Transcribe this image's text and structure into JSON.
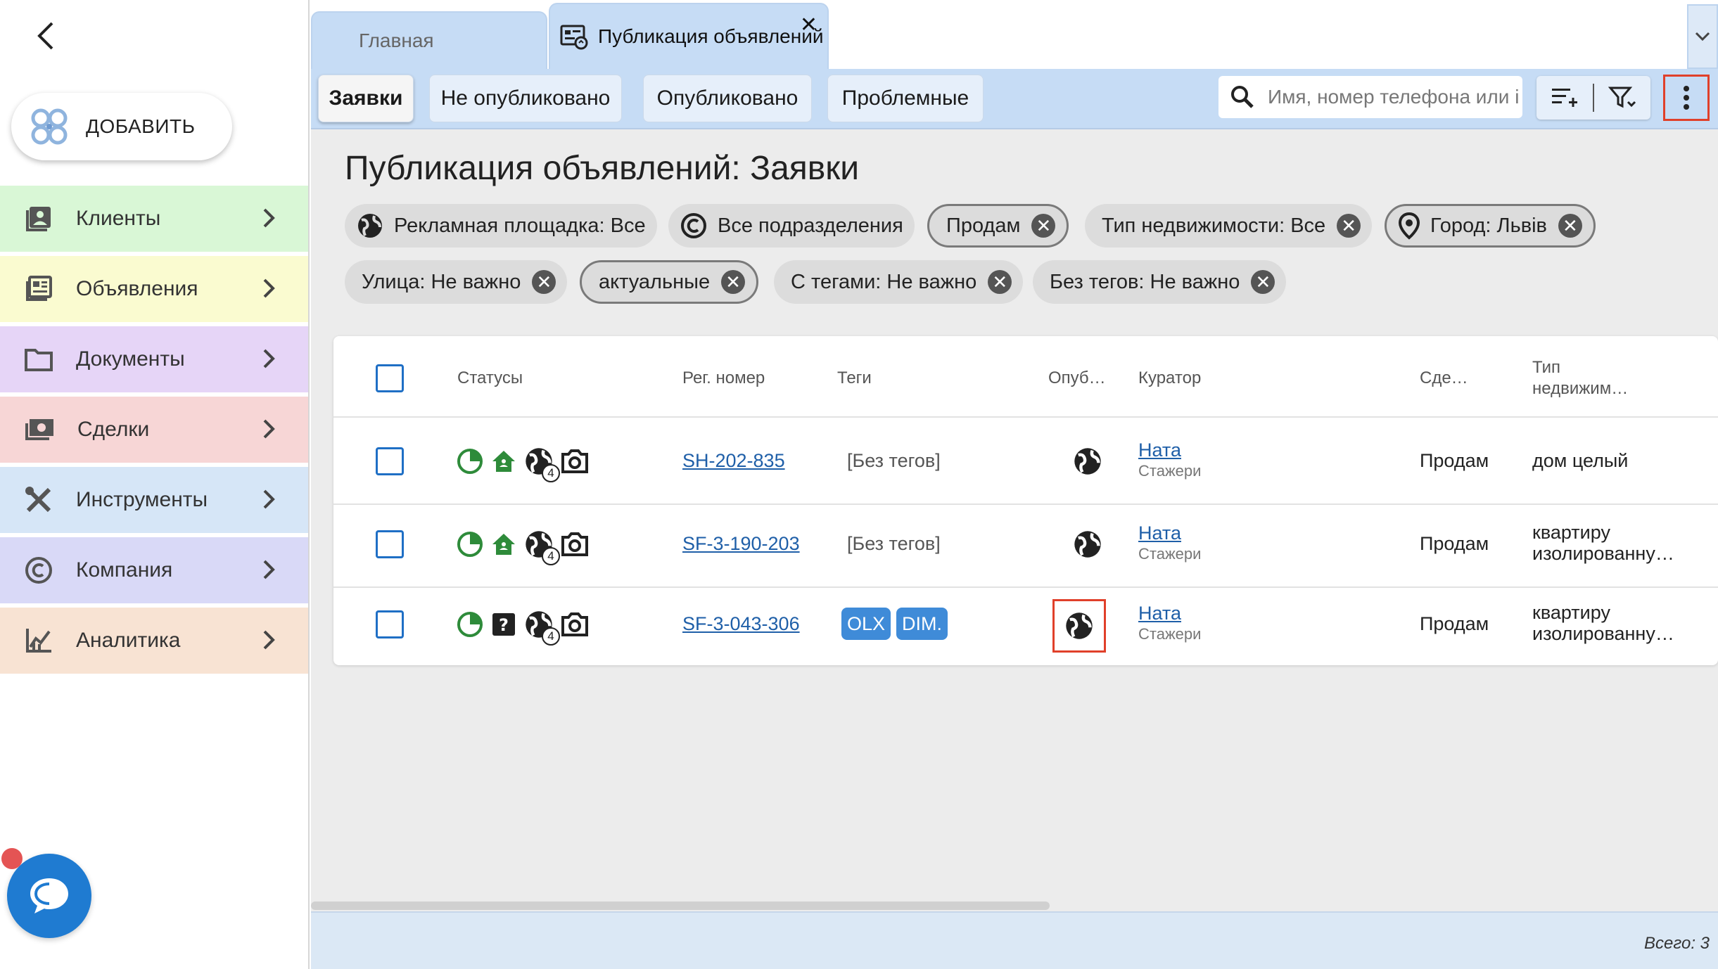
{
  "sidebar": {
    "add_label": "ДОБАВИТЬ",
    "items": [
      {
        "label": "Клиенты",
        "color": "#d9f7d6"
      },
      {
        "label": "Объявления",
        "color": "#fafbd0"
      },
      {
        "label": "Документы",
        "color": "#e6d5f7"
      },
      {
        "label": "Сделки",
        "color": "#f7d6d6"
      },
      {
        "label": "Инструменты",
        "color": "#d6e6f7"
      },
      {
        "label": "Компания",
        "color": "#d9d9f7"
      },
      {
        "label": "Аналитика",
        "color": "#f8e3d3"
      }
    ]
  },
  "tabs": {
    "home": "Главная",
    "active": "Публикация объявлений",
    "close": "✕"
  },
  "toolbar": {
    "tabs": [
      "Заявки",
      "Не опубликовано",
      "Опубликовано",
      "Проблемные"
    ],
    "search_placeholder": "Имя, номер телефона или i"
  },
  "page": {
    "title": "Публикация объявлений: Заявки"
  },
  "filters": [
    {
      "label": "Рекламная площадка: Все",
      "icon": "globe-icon",
      "removable": false,
      "outlined": false
    },
    {
      "label": "Все подразделения",
      "icon": "copyright-icon",
      "removable": false,
      "outlined": false
    },
    {
      "label": "Продам",
      "icon": null,
      "removable": true,
      "outlined": true
    },
    {
      "label": "Тип недвижимости: Все",
      "icon": null,
      "removable": true,
      "outlined": false
    },
    {
      "label": "Город: Львів",
      "icon": "location-pin-icon",
      "removable": true,
      "outlined": true
    },
    {
      "label": "Улица: Не важно",
      "icon": null,
      "removable": true,
      "outlined": false
    },
    {
      "label": "актуальные",
      "icon": null,
      "removable": true,
      "outlined": true
    },
    {
      "label": "С тегами: Не важно",
      "icon": null,
      "removable": true,
      "outlined": false
    },
    {
      "label": "Без тегов: Не важно",
      "icon": null,
      "removable": true,
      "outlined": false
    }
  ],
  "table": {
    "headers": {
      "statuses": "Статусы",
      "reg": "Рег. номер",
      "tags": "Теги",
      "pub": "Опуб…",
      "curator": "Куратор",
      "deal": "Сде…",
      "type_line1": "Тип",
      "type_line2": "недвижим…"
    },
    "rows": [
      {
        "reg": "SH-202-835",
        "tags_text": "[Без тегов]",
        "tags": [],
        "curator": "Ната",
        "curator_sub": "Стажери",
        "deal": "Продам",
        "type_line1": "дом целый",
        "type_line2": "",
        "status2": "house-icon",
        "globe_count": "4"
      },
      {
        "reg": "SF-3-190-203",
        "tags_text": "[Без тегов]",
        "tags": [],
        "curator": "Ната",
        "curator_sub": "Стажери",
        "deal": "Продам",
        "type_line1": "квартиру",
        "type_line2": "изолированну…",
        "status2": "house-icon",
        "globe_count": "4"
      },
      {
        "reg": "SF-3-043-306",
        "tags_text": "",
        "tags": [
          "OLX",
          "DIM."
        ],
        "curator": "Ната",
        "curator_sub": "Стажери",
        "deal": "Продам",
        "type_line1": "квартиру",
        "type_line2": "изолированну…",
        "status2": "question-icon",
        "globe_count": "4"
      }
    ]
  },
  "footer": {
    "total": "Всего: 3"
  },
  "colors": {
    "accent_blue": "#1f6fc5",
    "status_green": "#2e8b3a",
    "highlight_red": "#e0402a"
  }
}
